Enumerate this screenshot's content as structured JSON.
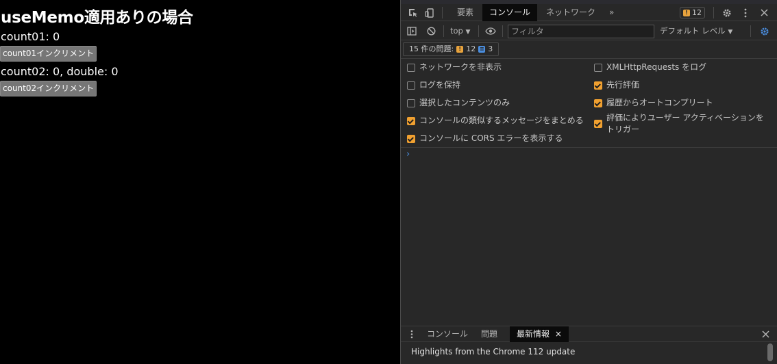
{
  "page": {
    "heading": "useMemo適用ありの場合",
    "count01_text": "count01: 0",
    "count01_button": "count01インクリメント",
    "count02_text": "count02: 0, double: 0",
    "count02_button": "count02インクリメント"
  },
  "devtools": {
    "tabs": [
      {
        "label": "要素"
      },
      {
        "label": "コンソール"
      },
      {
        "label": "ネットワーク"
      }
    ],
    "more_tabs": "»",
    "issues_badge_count": "12",
    "toolbar": {
      "context": "top",
      "filter_placeholder": "フィルタ",
      "level": "デフォルト レベル"
    },
    "issues_bar": {
      "label": "15 件の問題:",
      "warning_count": "12",
      "info_count": "3"
    },
    "settings": {
      "left": [
        {
          "label": "ネットワークを非表示",
          "checked": false
        },
        {
          "label": "ログを保持",
          "checked": false
        },
        {
          "label": "選択したコンテンツのみ",
          "checked": false
        },
        {
          "label": "コンソールの類似するメッセージをまとめる",
          "checked": true
        },
        {
          "label": "コンソールに CORS エラーを表示する",
          "checked": true
        }
      ],
      "right": [
        {
          "label": "XMLHttpRequests をログ",
          "checked": false
        },
        {
          "label": "先行評価",
          "checked": true
        },
        {
          "label": "履歴からオートコンプリート",
          "checked": true
        },
        {
          "label": "評価によりユーザー アクティベーションを",
          "label2": "トリガー",
          "checked": true
        }
      ]
    },
    "prompt": "›",
    "drawer": {
      "tabs": [
        {
          "label": "コンソール"
        },
        {
          "label": "問題"
        },
        {
          "label": "最新情報"
        }
      ],
      "close_tab": "×",
      "close_drawer": "×",
      "content": "Highlights from the Chrome 112 update"
    }
  }
}
